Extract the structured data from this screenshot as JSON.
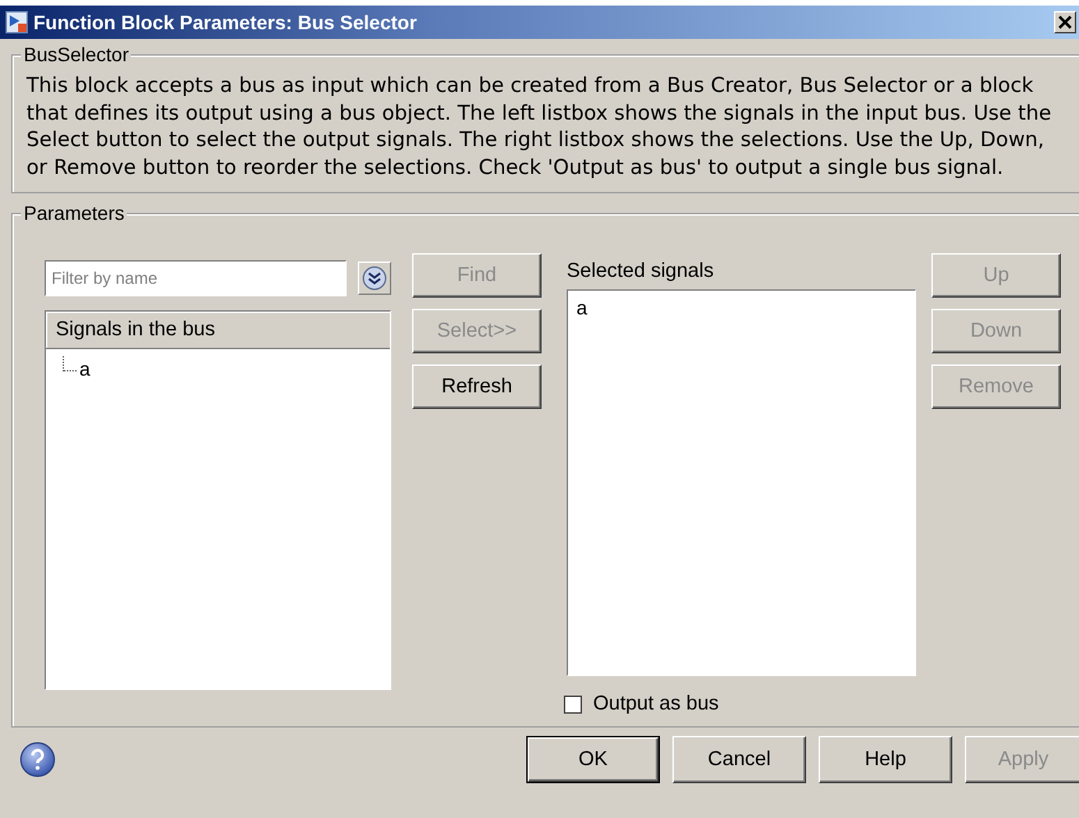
{
  "window": {
    "title": "Function Block Parameters: Bus Selector"
  },
  "block_group": {
    "title": "BusSelector",
    "description": "This block accepts a bus as input which can be created from a Bus Creator, Bus Selector or a block that defines its output using a bus object. The left listbox shows the signals in the input bus. Use the Select button to select the output signals. The right listbox shows the selections. Use the Up, Down, or Remove button to reorder the selections. Check 'Output as bus' to output a single bus signal."
  },
  "parameters": {
    "title": "Parameters",
    "filter": {
      "placeholder": "Filter by name"
    },
    "signals_tree": {
      "header": "Signals in the bus",
      "items": [
        {
          "label": "a"
        }
      ]
    },
    "middle_buttons": [
      {
        "label": "Find",
        "disabled": true
      },
      {
        "label": "Select>>",
        "disabled": true
      },
      {
        "label": "Refresh",
        "disabled": false
      }
    ],
    "selected_label": "Selected signals",
    "selected_items": [
      {
        "label": "a",
        "selected": false
      }
    ],
    "side_buttons": [
      {
        "label": "Up",
        "disabled": true
      },
      {
        "label": "Down",
        "disabled": true
      },
      {
        "label": "Remove",
        "disabled": true
      }
    ],
    "output_as_bus": {
      "label": "Output as bus",
      "checked": false
    }
  },
  "footer_buttons": [
    {
      "label": "OK",
      "default": true,
      "disabled": false
    },
    {
      "label": "Cancel",
      "default": false,
      "disabled": false
    },
    {
      "label": "Help",
      "default": false,
      "disabled": false
    },
    {
      "label": "Apply",
      "default": false,
      "disabled": true
    }
  ]
}
